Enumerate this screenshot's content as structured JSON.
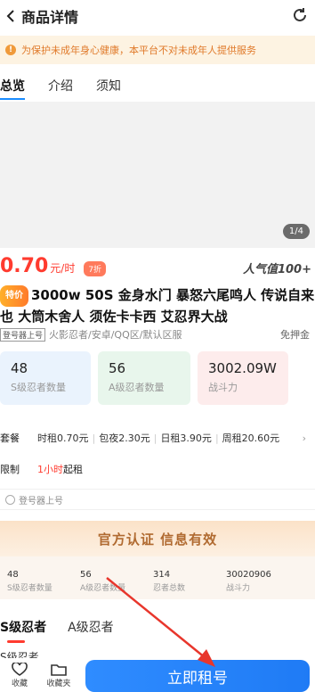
{
  "header": {
    "title": "商品详情"
  },
  "notice": {
    "text": "为保护未成年身心健康，本平台不对未成年人提供服务"
  },
  "tabs": [
    "总览",
    "介绍",
    "须知"
  ],
  "gallery": {
    "pager": "1/4"
  },
  "price": {
    "value": "0.70",
    "unit": "元/时",
    "discount": "7折",
    "popularity": "人气值100+"
  },
  "product": {
    "badge": "特价",
    "name": "3000w 50S 金身水门 暴怒六尾鸣人 传说自来也 大筒木舍人 须佐卡卡西 艾忍界大战"
  },
  "meta": {
    "tag": "登号器上号",
    "info": "火影忍者/安卓/QQ区/默认区服",
    "free": "免押金"
  },
  "stats": [
    {
      "value": "48",
      "label": "S级忍者数量"
    },
    {
      "value": "56",
      "label": "A级忍者数量"
    },
    {
      "value": "3002.09W",
      "label": "战斗力"
    }
  ],
  "package": {
    "label": "套餐",
    "items": [
      "时租0.70元",
      "包夜2.30元",
      "日租3.90元",
      "周租20.60元"
    ]
  },
  "limit": {
    "label": "限制",
    "hours": "1小时",
    "suffix": "起租"
  },
  "launcher": {
    "text": "登号器上号"
  },
  "official": {
    "text": "官方认证 信息有效"
  },
  "summary": [
    {
      "value": "48",
      "label": "S级忍者数量"
    },
    {
      "value": "56",
      "label": "A级忍者数量"
    },
    {
      "value": "314",
      "label": "忍者总数"
    },
    {
      "value": "30020906",
      "label": "战斗力"
    }
  ],
  "subtabs": [
    "S级忍者",
    "A级忍者"
  ],
  "peek": "S级忍者",
  "bottom": {
    "favorite": "收藏",
    "collection": "收藏夹",
    "rent": "立即租号"
  }
}
